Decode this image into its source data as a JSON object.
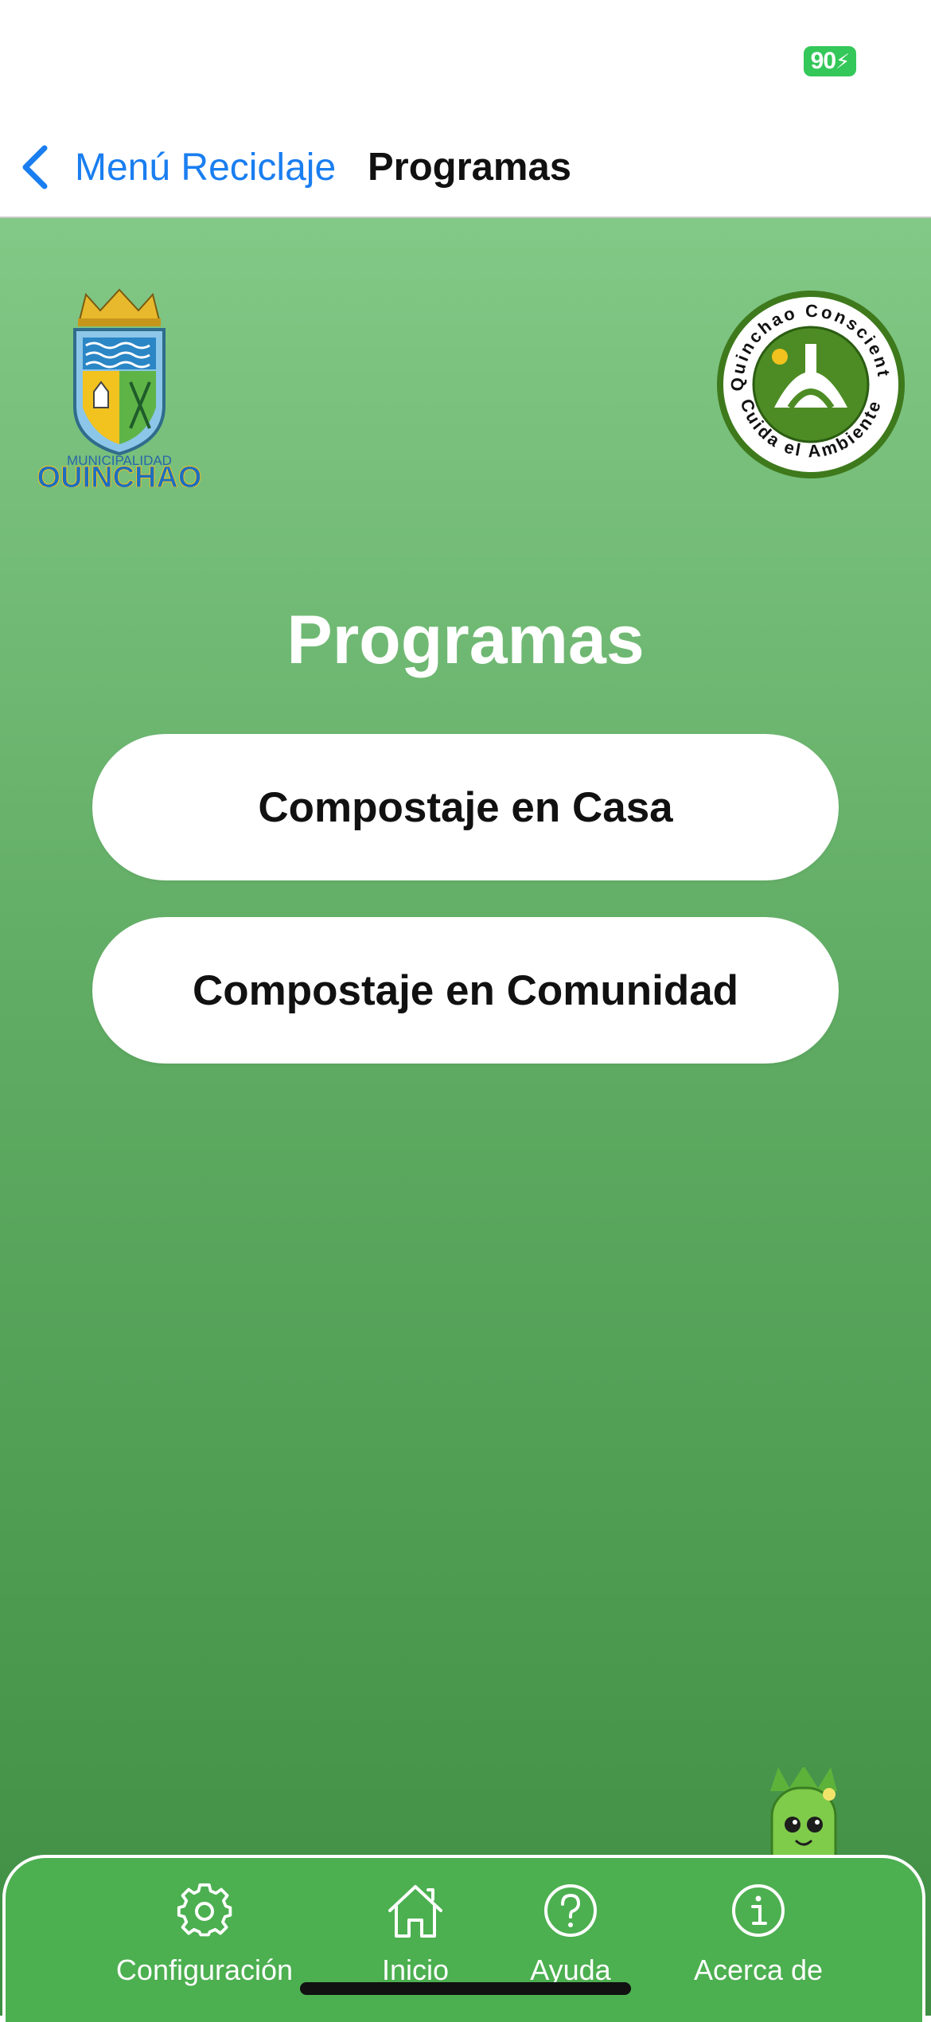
{
  "status": {
    "battery": "90"
  },
  "nav": {
    "back_label": "Menú Reciclaje",
    "title": "Programas"
  },
  "logos": {
    "municipality": {
      "line1": "MUNICIPALIDAD",
      "line2": "QUINCHAO"
    },
    "campaign": {
      "top_text": "Quinchao Consciente",
      "bottom_text": "Cuida el Ambiente"
    }
  },
  "main": {
    "heading": "Programas",
    "buttons": [
      {
        "label": "Compostaje en Casa"
      },
      {
        "label": "Compostaje en Comunidad"
      }
    ]
  },
  "tabs": [
    {
      "label": "Configuración",
      "icon": "gear-icon"
    },
    {
      "label": "Inicio",
      "icon": "home-icon"
    },
    {
      "label": "Ayuda",
      "icon": "help-icon"
    },
    {
      "label": "Acerca de",
      "icon": "info-icon"
    }
  ],
  "colors": {
    "accent": "#1a7ef0",
    "tab_bar": "#4caf50",
    "battery": "#34c759"
  }
}
